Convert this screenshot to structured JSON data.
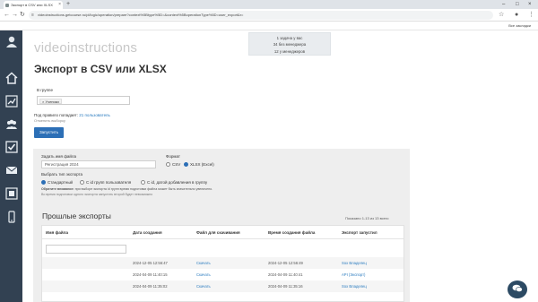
{
  "browser": {
    "tab_title": "Экспорт в CSV или XLSX",
    "url": "videoinstructions.getcourse.ru/pl/logic/operation/prepare?context%5Btype%5D=&context%5BoperationType%5D=user_export&r=",
    "bookmarks_all": "Все закладки"
  },
  "sidebar": {
    "icons": [
      "user-avatar-icon",
      "home-icon",
      "chart-icon",
      "users-icon",
      "checkbox-icon",
      "mail-icon",
      "integration-icon",
      "phone-icon"
    ]
  },
  "header": {
    "logo": "videoinstructions",
    "info_lines": [
      "1 задача у вас",
      "34 без менеджера",
      "12 у менеджеров"
    ]
  },
  "page": {
    "title": "Экспорт в CSV или XLSX",
    "group_label": "В группе",
    "group_chip": "× Ученики",
    "match_text": "Под правило попадает:",
    "match_count": "21 пользователь",
    "clear_link": "Отменить выборку",
    "run_button": "Запустить"
  },
  "form": {
    "filename_label": "Задать имя файла",
    "filename_value": "Регистрация 2024",
    "format_label": "Формат",
    "format_options": [
      "CSV",
      "XLSX (Excel)"
    ],
    "format_selected": "XLSX (Excel)",
    "type_label": "Выбрать тип экспорта",
    "type_options": [
      "Стандартный",
      "С id групп пользователя",
      "С id, датой добавления в группу"
    ],
    "type_selected": "Стандартный",
    "notice_bold": "Обратите внимание:",
    "notice_text": "при выборе экспорта id групп время подготовки файла может быть значительно увеличено.",
    "notice2": "Во время подготовки одного экспорта запустить второй будет невозможно"
  },
  "exports": {
    "title": "Прошлые экспорты",
    "showing": "Показано 1-13 из 13 всего",
    "columns": [
      "Имя файла",
      "Дата создания",
      "Файл для скачивания",
      "Время создания файла",
      "Экспорт запустил"
    ],
    "rows": [
      {
        "name": "",
        "created": "2024-12-05 12:56:47",
        "download": "Скачать",
        "file_time": "2024-12-05 12:56:49",
        "by": "Sox Владелец"
      },
      {
        "name": "",
        "created": "2024-04-09 11:40:15",
        "download": "Скачать",
        "file_time": "2024-04-09 11:40:41",
        "by": "API (Экспорт)"
      },
      {
        "name": "",
        "created": "2024-04-09 11:35:02",
        "download": "Скачать",
        "file_time": "2024-04-09 11:35:16",
        "by": "Sox Владелец"
      }
    ]
  },
  "colors": {
    "sidebar": "#324152",
    "primary": "#2c6fb6",
    "link": "#2a7bbf",
    "panel": "#eeeeee"
  }
}
